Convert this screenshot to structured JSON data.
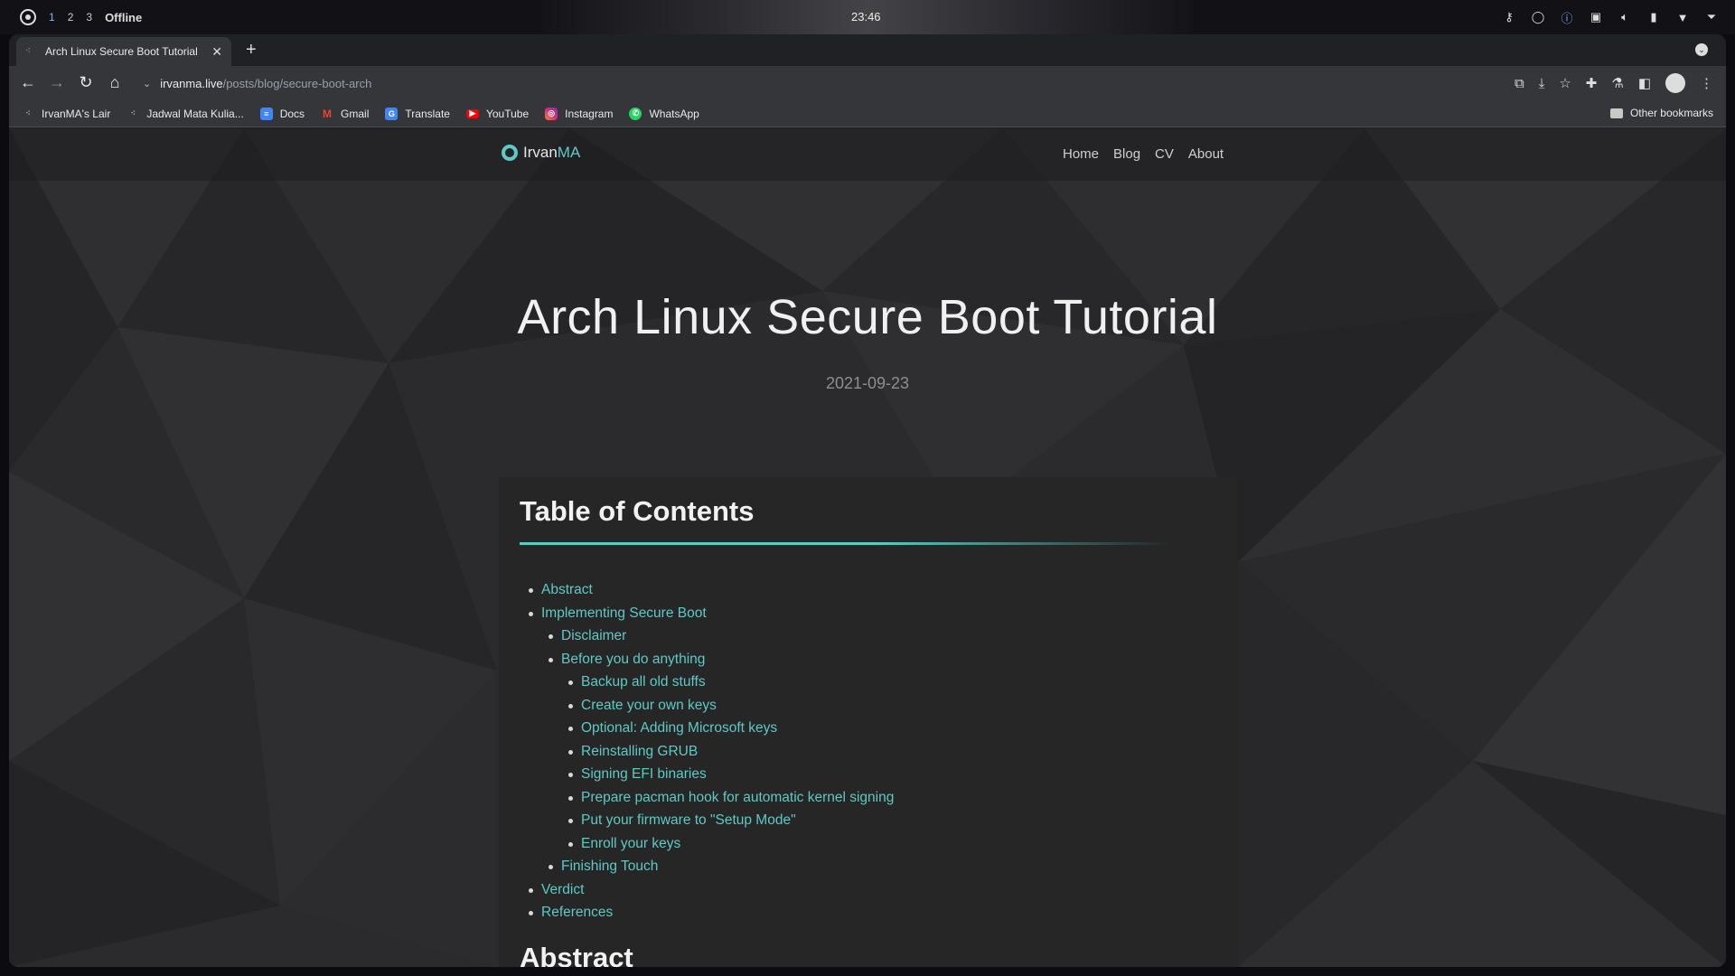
{
  "system": {
    "workspaces": [
      "1",
      "2",
      "3"
    ],
    "status": "Offline",
    "clock": "23:46"
  },
  "browser": {
    "tab_title": "Arch Linux Secure Boot Tutorial",
    "url_host": "irvanma.live",
    "url_path": "/posts/blog/secure-boot-arch",
    "bookmarks": [
      {
        "label": "IrvanMA's Lair",
        "icon": "site-favicon-icon"
      },
      {
        "label": "Jadwal Mata Kulia...",
        "icon": "site-favicon-icon"
      },
      {
        "label": "Docs",
        "icon": "docs-icon",
        "color": "#4285f4"
      },
      {
        "label": "Gmail",
        "icon": "gmail-icon",
        "color": "#ea4335"
      },
      {
        "label": "Translate",
        "icon": "translate-icon",
        "color": "#4285f4"
      },
      {
        "label": "YouTube",
        "icon": "youtube-icon",
        "color": "#ff0000"
      },
      {
        "label": "Instagram",
        "icon": "instagram-icon",
        "color": "#e1306c"
      },
      {
        "label": "WhatsApp",
        "icon": "whatsapp-icon",
        "color": "#25d366"
      }
    ],
    "other_bookmarks": "Other bookmarks"
  },
  "site": {
    "brand_first": "Irvan",
    "brand_accent": "MA",
    "accent_color": "#5fc9c4",
    "nav": [
      "Home",
      "Blog",
      "CV",
      "About"
    ]
  },
  "post": {
    "title": "Arch Linux Secure Boot Tutorial",
    "date": "2021-09-23",
    "toc_heading": "Table of Contents",
    "toc": [
      {
        "label": "Abstract",
        "level": 1
      },
      {
        "label": "Implementing Secure Boot",
        "level": 1
      },
      {
        "label": "Disclaimer",
        "level": 2
      },
      {
        "label": "Before you do anything",
        "level": 2
      },
      {
        "label": "Backup all old stuffs",
        "level": 3
      },
      {
        "label": "Create your own keys",
        "level": 3
      },
      {
        "label": "Optional: Adding Microsoft keys",
        "level": 3
      },
      {
        "label": "Reinstalling GRUB",
        "level": 3
      },
      {
        "label": "Signing EFI binaries",
        "level": 3
      },
      {
        "label": "Prepare pacman hook for automatic kernel signing",
        "level": 3
      },
      {
        "label": "Put your firmware to \"Setup Mode\"",
        "level": 3
      },
      {
        "label": "Enroll your keys",
        "level": 3
      },
      {
        "label": "Finishing Touch",
        "level": 2
      },
      {
        "label": "Verdict",
        "level": 1
      },
      {
        "label": "References",
        "level": 1
      }
    ],
    "section_heading": "Abstract"
  }
}
